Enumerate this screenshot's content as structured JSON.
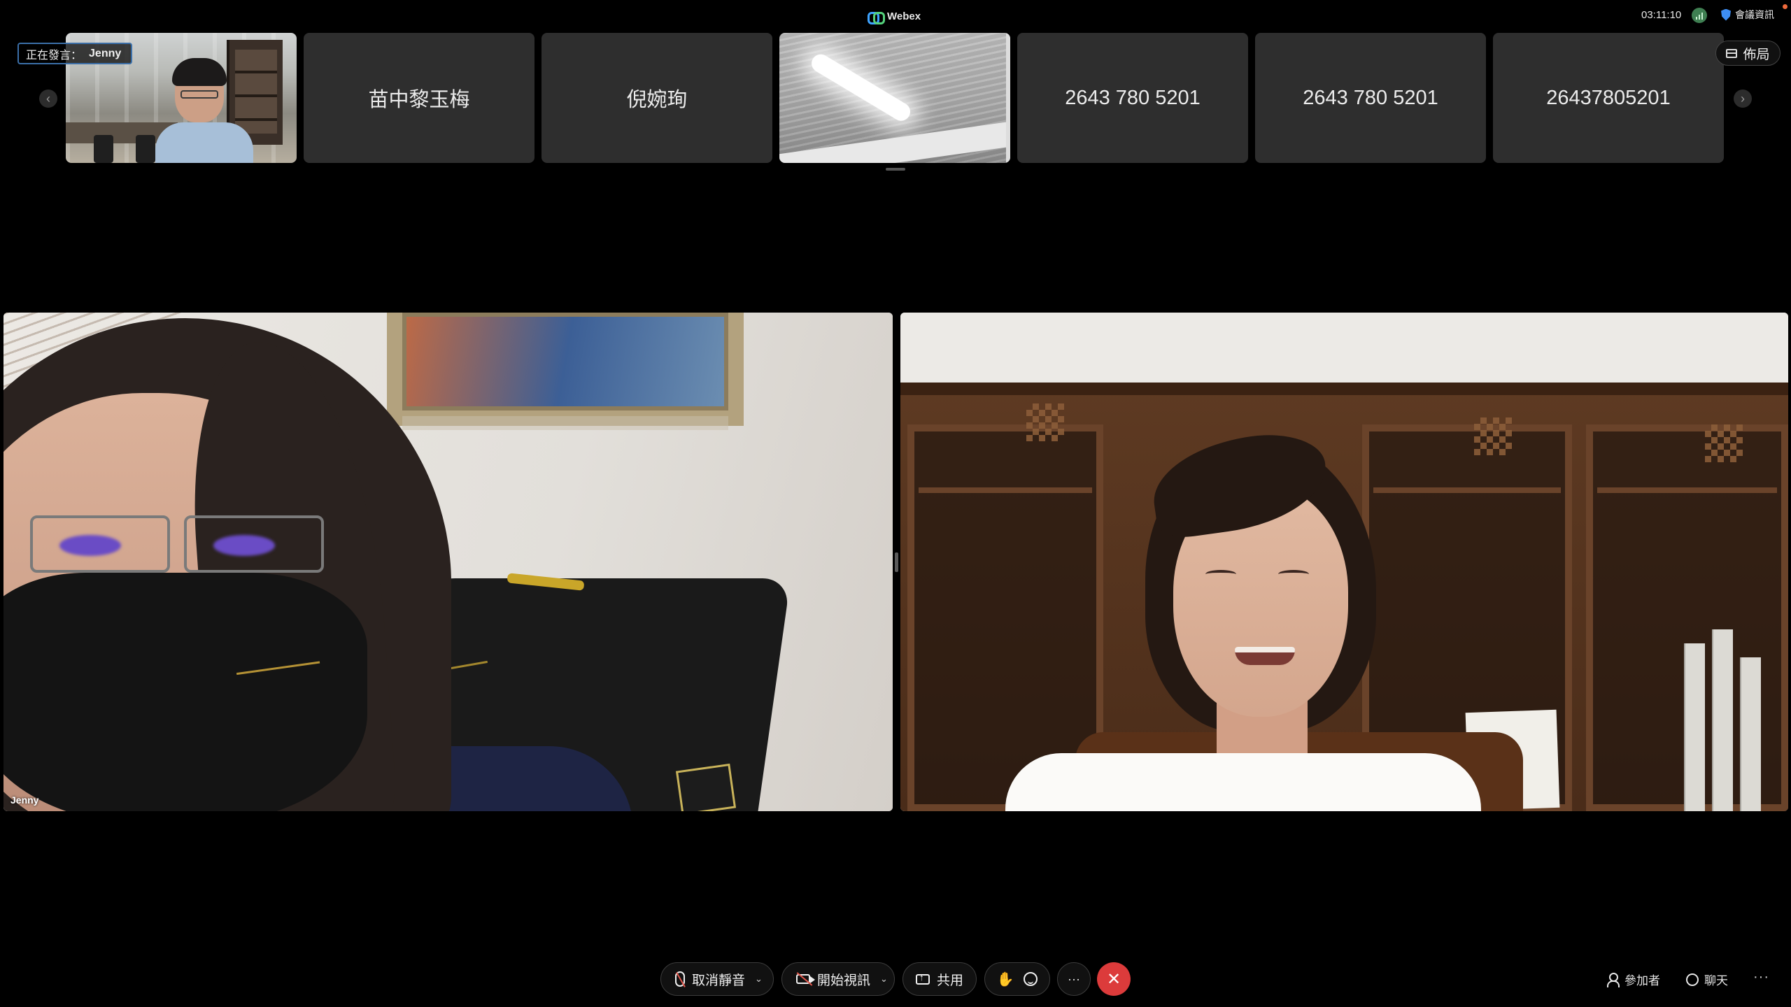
{
  "app": {
    "title": "Webex",
    "clock": "03:11:10",
    "meeting_info_label": "會議資訊",
    "layout_label": "佈局"
  },
  "speaking": {
    "prefix": "正在發言：",
    "speaker": "Jenny"
  },
  "strip": {
    "prev_arrow": "‹",
    "next_arrow": "›",
    "tiles": [
      {
        "label": ""
      },
      {
        "label": "苗中黎玉梅"
      },
      {
        "label": "倪婉珣"
      },
      {
        "label": ""
      },
      {
        "label": "2643 780 5201"
      },
      {
        "label": "2643 780 5201"
      },
      {
        "label": "26437805201"
      }
    ]
  },
  "main_panes": {
    "left_name": "Jenny"
  },
  "toolbar": {
    "mute_label": "取消靜音",
    "video_label": "開始視訊",
    "share_label": "共用",
    "chevron": "⌄",
    "hand_glyph": "✋",
    "more_glyph": "···",
    "leave_glyph": "✕",
    "participants_label": "參加者",
    "chat_label": "聊天",
    "overflow_glyph": "···"
  },
  "icons": [
    "webex-logo",
    "network-icon",
    "shield-icon",
    "layout-icon",
    "microphone-off-icon",
    "camera-off-icon",
    "share-screen-icon",
    "raise-hand-icon",
    "reactions-icon",
    "more-icon",
    "leave-icon",
    "participants-icon",
    "chat-icon"
  ],
  "colors": {
    "leave_red": "#dc3b3b",
    "speaking_border": "#3b6fa8",
    "tile_bg": "#2e2e2e",
    "background": "#000000"
  }
}
